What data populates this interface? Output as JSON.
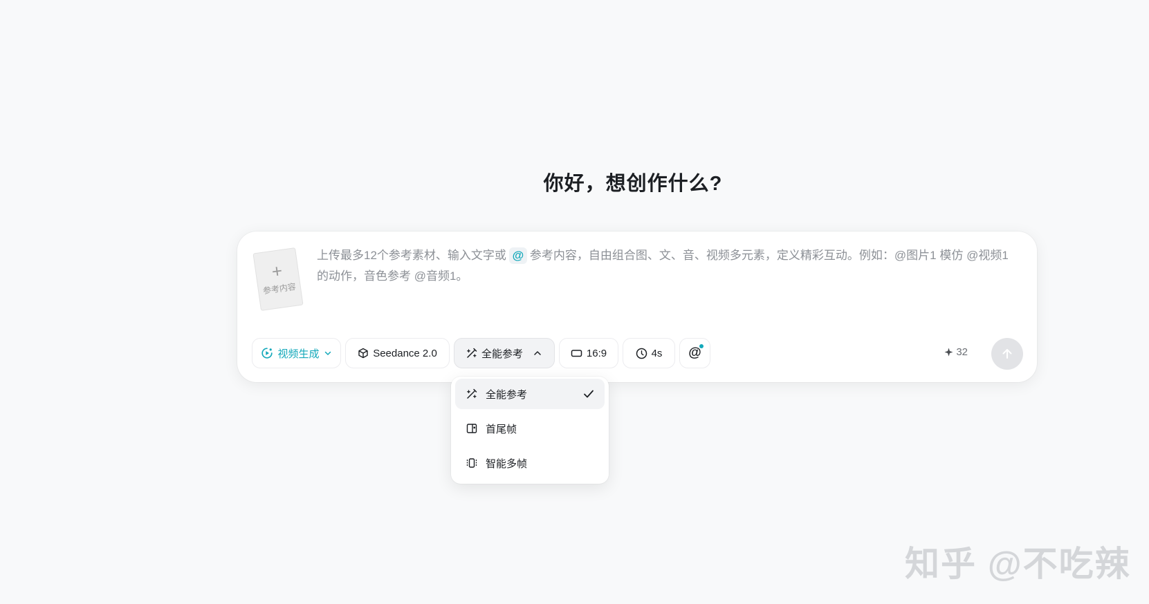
{
  "greeting": "你好，想创作什么?",
  "composer": {
    "reference_card_label": "参考内容",
    "prompt_before_at": "上传最多12个参考素材、输入文字或",
    "at_symbol": "@",
    "prompt_after_at": "参考内容，自由组合图、文、音、视频多元素，定义精彩互动。例如：@图片1 模仿 @视频1 的动作，音色参考 @音频1。"
  },
  "toolbar": {
    "mode_label": "视频生成",
    "model_label": "Seedance 2.0",
    "reference_label": "全能参考",
    "ratio_label": "16:9",
    "duration_label": "4s",
    "mention_label": "@",
    "credits": "32"
  },
  "dropdown": {
    "items": [
      {
        "label": "全能参考",
        "icon": "wand-icon",
        "selected": true
      },
      {
        "label": "首尾帧",
        "icon": "frame-icon",
        "selected": false
      },
      {
        "label": "智能多帧",
        "icon": "multiframe-icon",
        "selected": false
      }
    ]
  },
  "colors": {
    "accent": "#13a8ba",
    "background": "#f8f9fa",
    "selected_bg": "#f2f3f5",
    "send_disabled": "#e2e3e6"
  },
  "watermark": "知乎 @不吃辣"
}
